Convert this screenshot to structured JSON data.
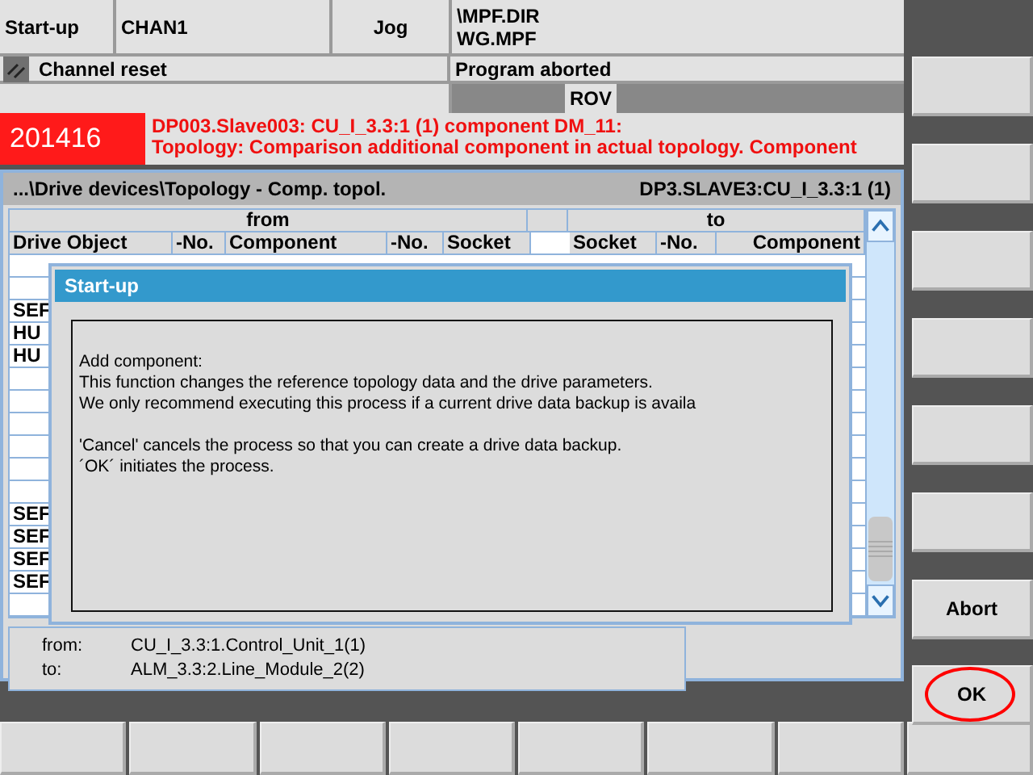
{
  "header": {
    "area": "Start-up",
    "channel": "CHAN1",
    "mode": "Jog",
    "program_path": "\\MPF.DIR",
    "program_name": "WG.MPF",
    "channel_status": "Channel reset",
    "program_status": "Program aborted",
    "override_indicator": "ROV"
  },
  "alarm": {
    "number": "201416",
    "lines": [
      "DP003.Slave003: CU_I_3.3:1 (1) component DM_11:",
      "Topology: Comparison additional component in actual topology. Component"
    ]
  },
  "panel": {
    "path": "...\\Drive devices\\Topology - Comp. topol.",
    "device": "DP3.SLAVE3:CU_I_3.3:1 (1)"
  },
  "table": {
    "groups": [
      "from",
      "to"
    ],
    "columns": [
      "Drive Object",
      "-No.",
      "Component",
      "-No.",
      "Socket",
      "Socket",
      "-No.",
      "Component"
    ],
    "rows": [
      {
        "kind": "blank"
      },
      {
        "kind": "blank"
      },
      {
        "kind": "text",
        "drive_object": "SEF"
      },
      {
        "kind": "text",
        "drive_object": "HU"
      },
      {
        "kind": "text",
        "drive_object": "HU"
      },
      {
        "kind": "blank"
      },
      {
        "kind": "blank"
      },
      {
        "kind": "blank"
      },
      {
        "kind": "blank"
      },
      {
        "kind": "blank"
      },
      {
        "kind": "blank"
      },
      {
        "kind": "text",
        "drive_object": "SEF"
      },
      {
        "kind": "text",
        "drive_object": "SEF"
      },
      {
        "kind": "text",
        "drive_object": "SEF"
      },
      {
        "kind": "text",
        "drive_object": "SEF"
      },
      {
        "kind": "blank"
      }
    ]
  },
  "dialog": {
    "title": "Start-up",
    "blocks": [
      [
        "Add component:",
        "This function changes the reference topology data and the drive parameters.",
        "We only recommend executing this process if a current drive data backup is availa"
      ],
      [
        "'Cancel' cancels the process so that you can create a drive data backup.",
        "´OK´ initiates the process."
      ]
    ]
  },
  "info": [
    {
      "label": "from:",
      "value": "CU_I_3.3:1.Control_Unit_1(1)"
    },
    {
      "label": "to:",
      "value": "ALM_3.3:2.Line_Module_2(2)"
    }
  ],
  "vertical_softkeys": [
    {
      "kind": "blank"
    },
    {
      "kind": "blank"
    },
    {
      "kind": "blank"
    },
    {
      "kind": "blank"
    },
    {
      "kind": "blank"
    },
    {
      "kind": "blank"
    },
    {
      "kind": "labeled",
      "label": "Abort",
      "highlighted": false
    },
    {
      "kind": "labeled",
      "label": "OK",
      "highlighted": true
    }
  ],
  "horizontal_softkeys": [
    {
      "kind": "blank"
    },
    {
      "kind": "blank"
    },
    {
      "kind": "blank"
    },
    {
      "kind": "blank"
    },
    {
      "kind": "blank"
    },
    {
      "kind": "blank"
    },
    {
      "kind": "blank"
    },
    {
      "kind": "blank"
    }
  ]
}
